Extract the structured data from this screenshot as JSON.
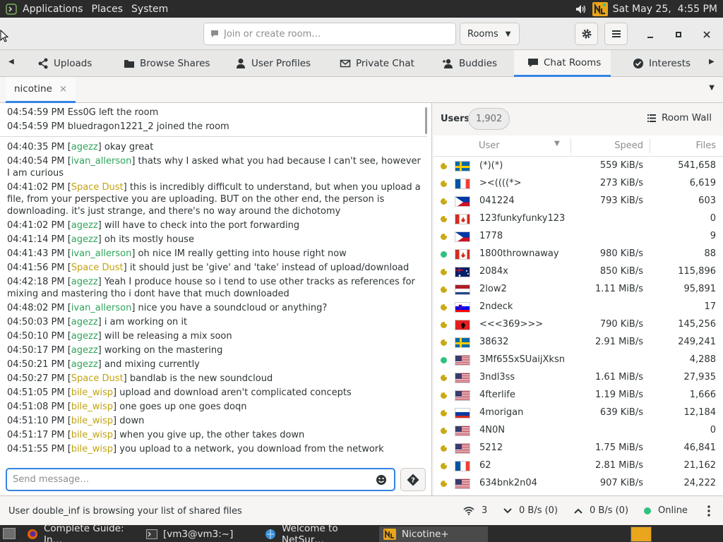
{
  "top_panel": {
    "menus": [
      "Applications",
      "Places",
      "System"
    ],
    "datetime": "Sat May 25,  4:55 PM"
  },
  "header": {
    "room_placeholder": "Join or create room…",
    "rooms_label": "Rooms"
  },
  "tabs": [
    {
      "label": "Uploads",
      "icon": "share-icon"
    },
    {
      "label": "Browse Shares",
      "icon": "folder-icon"
    },
    {
      "label": "User Profiles",
      "icon": "person-icon"
    },
    {
      "label": "Private Chat",
      "icon": "mail-icon"
    },
    {
      "label": "Buddies",
      "icon": "add-user-icon"
    },
    {
      "label": "Chat Rooms",
      "icon": "chat-icon",
      "active": true
    },
    {
      "label": "Interests",
      "icon": "check-circle-icon"
    }
  ],
  "room_tab": {
    "label": "nicotine",
    "close": "×"
  },
  "activity": [
    "04:54:59 PM Ess0G left the room",
    "04:54:59 PM bluedragon1221_2 joined the room"
  ],
  "messages": [
    {
      "time": "04:40:35 PM",
      "user": "agezz",
      "color": "green",
      "text": " okay great"
    },
    {
      "time": "04:40:54 PM",
      "user": "ivan_allerson",
      "color": "green",
      "text": " thats why I asked what you had because I can't see, however I am curious"
    },
    {
      "time": "04:41:02 PM",
      "user": "Space Dust",
      "color": "yellow",
      "text": " this is incredibly difficult to understand, but when you upload a file, from your perspective you are uploading. BUT on the other end, the person is downloading. it's just strange, and there's no way around the dichotomy"
    },
    {
      "time": "04:41:02 PM",
      "user": "agezz",
      "color": "green",
      "text": " will have to check into the port forwarding"
    },
    {
      "time": "04:41:14 PM",
      "user": "agezz",
      "color": "green",
      "text": " oh its mostly house"
    },
    {
      "time": "04:41:43 PM",
      "user": "ivan_allerson",
      "color": "green",
      "text": " oh nice IM really getting into house right now"
    },
    {
      "time": "04:41:56 PM",
      "user": "Space Dust",
      "color": "yellow",
      "text": " it should just be 'give' and 'take' instead of upload/download"
    },
    {
      "time": "04:42:18 PM",
      "user": "agezz",
      "color": "green",
      "text": " Yeah I produce house so i tend to use other tracks as references for mixing and mastering tho i dont have that much downloaded"
    },
    {
      "time": "04:48:02 PM",
      "user": "ivan_allerson",
      "color": "green",
      "text": " nice you have a soundcloud or anything?"
    },
    {
      "time": "04:50:03 PM",
      "user": "agezz",
      "color": "green",
      "text": " i am working on it"
    },
    {
      "time": "04:50:10 PM",
      "user": "agezz",
      "color": "green",
      "text": " will be releasing a mix soon"
    },
    {
      "time": "04:50:17 PM",
      "user": "agezz",
      "color": "green",
      "text": " working on the mastering"
    },
    {
      "time": "04:50:21 PM",
      "user": "agezz",
      "color": "green",
      "text": " and mixing currently"
    },
    {
      "time": "04:50:27 PM",
      "user": "Space Dust",
      "color": "yellow",
      "text": " bandlab is the new soundcloud"
    },
    {
      "time": "04:51:05 PM",
      "user": "bile_wisp",
      "color": "yellow",
      "text": " upload and download aren't complicated concepts"
    },
    {
      "time": "04:51:08 PM",
      "user": "bile_wisp",
      "color": "yellow",
      "text": " one goes up one goes doqn"
    },
    {
      "time": "04:51:10 PM",
      "user": "bile_wisp",
      "color": "yellow",
      "text": " down"
    },
    {
      "time": "04:51:17 PM",
      "user": "bile_wisp",
      "color": "yellow",
      "text": " when you give up, the other takes down"
    },
    {
      "time": "04:51:55 PM",
      "user": "bile_wisp",
      "color": "yellow",
      "text": " you upload to a network, you download from the network"
    }
  ],
  "composer": {
    "placeholder": "Send message…"
  },
  "users_panel": {
    "label": "Users",
    "count": "1,902",
    "room_wall": "Room Wall",
    "columns": {
      "user": "User",
      "speed": "Speed",
      "files": "Files"
    },
    "rows": [
      {
        "status": "away",
        "flag": "se",
        "name": "(*)(*)",
        "speed": "559 KiB/s",
        "files": "541,658"
      },
      {
        "status": "away",
        "flag": "fr",
        "name": "><((((*>",
        "speed": "273 KiB/s",
        "files": "6,619"
      },
      {
        "status": "away",
        "flag": "ph",
        "name": "041224",
        "speed": "793 KiB/s",
        "files": "603"
      },
      {
        "status": "away",
        "flag": "ca",
        "name": "123funkyfunky123",
        "speed": "",
        "files": "0"
      },
      {
        "status": "away",
        "flag": "ph",
        "name": "1778",
        "speed": "",
        "files": "9"
      },
      {
        "status": "online",
        "flag": "ca",
        "name": "1800thrownaway",
        "speed": "980 KiB/s",
        "files": "88"
      },
      {
        "status": "away",
        "flag": "au",
        "name": "2084x",
        "speed": "850 KiB/s",
        "files": "115,896"
      },
      {
        "status": "away",
        "flag": "nl",
        "name": "2low2",
        "speed": "1.11 MiB/s",
        "files": "95,891"
      },
      {
        "status": "away",
        "flag": "si",
        "name": "2ndeck",
        "speed": "",
        "files": "17"
      },
      {
        "status": "away",
        "flag": "al",
        "name": "<<<369>>>",
        "speed": "790 KiB/s",
        "files": "145,256"
      },
      {
        "status": "away",
        "flag": "se",
        "name": "38632",
        "speed": "2.91 MiB/s",
        "files": "249,241"
      },
      {
        "status": "online",
        "flag": "us",
        "name": "3Mf65SxSUaijXksn",
        "speed": "",
        "files": "4,288"
      },
      {
        "status": "away",
        "flag": "us",
        "name": "3ndl3ss",
        "speed": "1.61 MiB/s",
        "files": "27,935"
      },
      {
        "status": "away",
        "flag": "us",
        "name": "4fterlife",
        "speed": "1.19 MiB/s",
        "files": "1,666"
      },
      {
        "status": "away",
        "flag": "ru",
        "name": "4morigan",
        "speed": "639 KiB/s",
        "files": "12,184"
      },
      {
        "status": "away",
        "flag": "us",
        "name": "4N0N",
        "speed": "",
        "files": "0"
      },
      {
        "status": "away",
        "flag": "us",
        "name": "5212",
        "speed": "1.75 MiB/s",
        "files": "46,841"
      },
      {
        "status": "away",
        "flag": "fr",
        "name": "62",
        "speed": "2.81 MiB/s",
        "files": "21,162"
      },
      {
        "status": "away",
        "flag": "us",
        "name": "634bnk2n04",
        "speed": "907 KiB/s",
        "files": "24,222"
      }
    ]
  },
  "statusbar": {
    "message": "User double_inf is browsing your list of shared files",
    "connections": "3",
    "down": "0 B/s (0)",
    "up": "0 B/s (0)",
    "status": "Online"
  },
  "taskbar": [
    {
      "label": "Complete Guide: In…",
      "icon": "firefox-icon"
    },
    {
      "label": "[vm3@vm3:~]",
      "icon": "terminal-icon"
    },
    {
      "label": "Welcome to NetSur…",
      "icon": "netsurf-icon"
    },
    {
      "label": "Nicotine+",
      "icon": "nicotine-icon",
      "active": true
    }
  ],
  "colors": {
    "accent": "#3584e4",
    "user_green": "#2ea35a",
    "user_yellow": "#c2a310",
    "online": "#2ec27e",
    "away": "#c9a915"
  }
}
